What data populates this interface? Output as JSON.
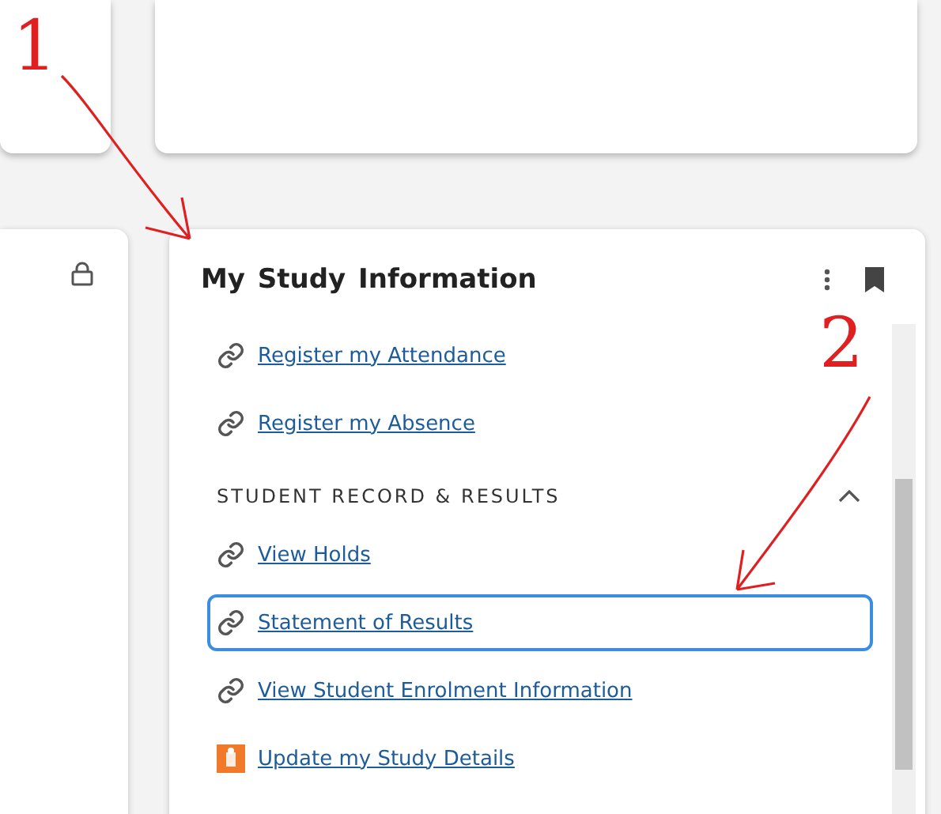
{
  "annotations": [
    {
      "label": "1"
    },
    {
      "label": "2"
    }
  ],
  "card": {
    "title": "My Study Information",
    "links": [
      {
        "kind": "link",
        "label": "Register my Attendance",
        "selected": false
      },
      {
        "kind": "link",
        "label": "Register my Absence",
        "selected": false
      }
    ],
    "section": {
      "title": "STUDENT RECORD & RESULTS",
      "expanded": true,
      "links": [
        {
          "kind": "link",
          "label": "View Holds",
          "selected": false
        },
        {
          "kind": "link",
          "label": "Statement of Results",
          "selected": true
        },
        {
          "kind": "link",
          "label": "View Student Enrolment Information",
          "selected": false
        },
        {
          "kind": "form",
          "label": "Update my Study Details",
          "selected": false
        }
      ]
    }
  }
}
